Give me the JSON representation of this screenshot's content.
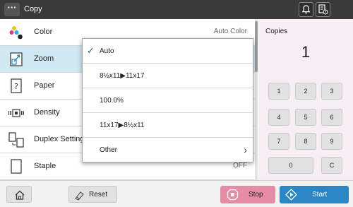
{
  "topbar": {
    "title": "Copy",
    "menu_glyph": "···"
  },
  "functions": [
    {
      "label": "Color",
      "value": "Auto  Color",
      "icon": "color-dots-icon"
    },
    {
      "label": "Zoom",
      "value": "",
      "icon": "zoom-icon",
      "selected": true
    },
    {
      "label": "Paper",
      "value": "",
      "icon": "paper-icon"
    },
    {
      "label": "Density",
      "value": "",
      "icon": "density-icon"
    },
    {
      "label": "Duplex  Setting",
      "value": "",
      "icon": "duplex-icon"
    },
    {
      "label": "Staple",
      "value": "OFF",
      "icon": "staple-icon"
    }
  ],
  "zoom_menu": {
    "options": [
      {
        "label": "Auto",
        "checked": true
      },
      {
        "label": "8½x11▶11x17"
      },
      {
        "label": "100.0%"
      },
      {
        "label": "11x17▶8½x11"
      },
      {
        "label": "Other",
        "has_submenu": true
      }
    ]
  },
  "copies": {
    "label": "Copies",
    "count": "1",
    "keys": [
      "1",
      "2",
      "3",
      "4",
      "5",
      "6",
      "7",
      "8",
      "9",
      "0",
      "C"
    ]
  },
  "bottom": {
    "reset_label": "Reset",
    "stop_label": "Stop",
    "start_label": "Start"
  },
  "colors": {
    "selected_row": "#cfe8f2",
    "stop": "#e78ba6",
    "start": "#2a86c5",
    "copies_panel": "#f7eef4"
  }
}
